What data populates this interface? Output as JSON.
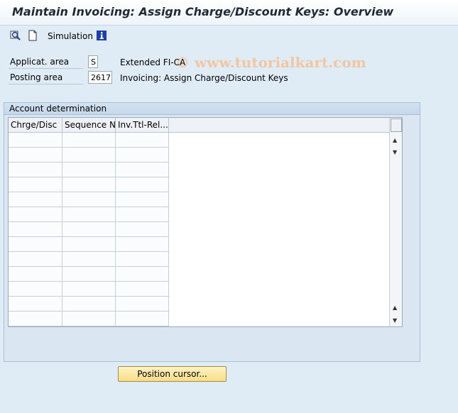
{
  "window": {
    "title": "Maintain Invoicing: Assign Charge/Discount Keys: Overview"
  },
  "toolbar": {
    "watermark": "© www.tutorialkart.com",
    "simulation_label": "Simulation",
    "icons": [
      "find-icon",
      "new-document-icon",
      "information-icon"
    ]
  },
  "fields": {
    "applicat_area_label": "Applicat. area",
    "applicat_area_value": "S",
    "applicat_area_desc": "Extended FI-CA",
    "posting_area_label": "Posting area",
    "posting_area_value": "2617",
    "posting_area_desc": "Invoicing: Assign Charge/Discount Keys"
  },
  "account_determination": {
    "title": "Account determination",
    "columns": [
      "Chrge/Disc",
      "Sequence N",
      "Inv.Ttl-Rel..."
    ]
  },
  "buttons": {
    "position_cursor": "Position cursor..."
  },
  "colors": {
    "button_accent": "#f8dd87",
    "background": "#dfebf5",
    "info_icon": "#1c3fa8"
  }
}
